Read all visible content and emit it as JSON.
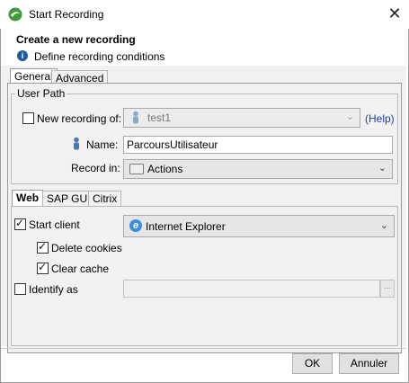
{
  "window": {
    "title": "Start Recording",
    "header_title": "Create a new recording",
    "header_subtitle": "Define recording conditions"
  },
  "tabs_main": [
    {
      "label": "General",
      "selected": true
    },
    {
      "label": "Advanced",
      "selected": false
    }
  ],
  "user_path": {
    "group_label": "User Path",
    "new_recording_label": "New recording of:",
    "new_recording_checked": false,
    "new_recording_value": "test1",
    "help_link": "(Help)",
    "name_label": "Name:",
    "name_value": "ParcoursUtilisateur",
    "record_in_label": "Record in:",
    "record_in_value": "Actions"
  },
  "tabs_client": [
    {
      "label": "Web",
      "selected": true
    },
    {
      "label": "SAP GUI",
      "selected": false
    },
    {
      "label": "Citrix",
      "selected": false
    }
  ],
  "web": {
    "start_client_label": "Start client",
    "start_client_checked": true,
    "browser_value": "Internet Explorer",
    "delete_cookies_label": "Delete cookies",
    "delete_cookies_checked": true,
    "clear_cache_label": "Clear cache",
    "clear_cache_checked": true,
    "identify_as_label": "Identify as",
    "identify_as_checked": false,
    "identify_as_value": "",
    "browse_label": "..."
  },
  "buttons": {
    "ok": "OK",
    "cancel": "Annuler"
  },
  "icons": {
    "app": "app-logo-icon",
    "close": "close-icon",
    "info": "info-icon",
    "user": "user-icon",
    "folder": "folder-icon",
    "browser": "internet-explorer-icon",
    "dropdown": "chevron-down-icon"
  },
  "colors": {
    "link": "#1b3fa8",
    "info": "#1e5aa0",
    "app_icon": "#3f9a3a"
  }
}
